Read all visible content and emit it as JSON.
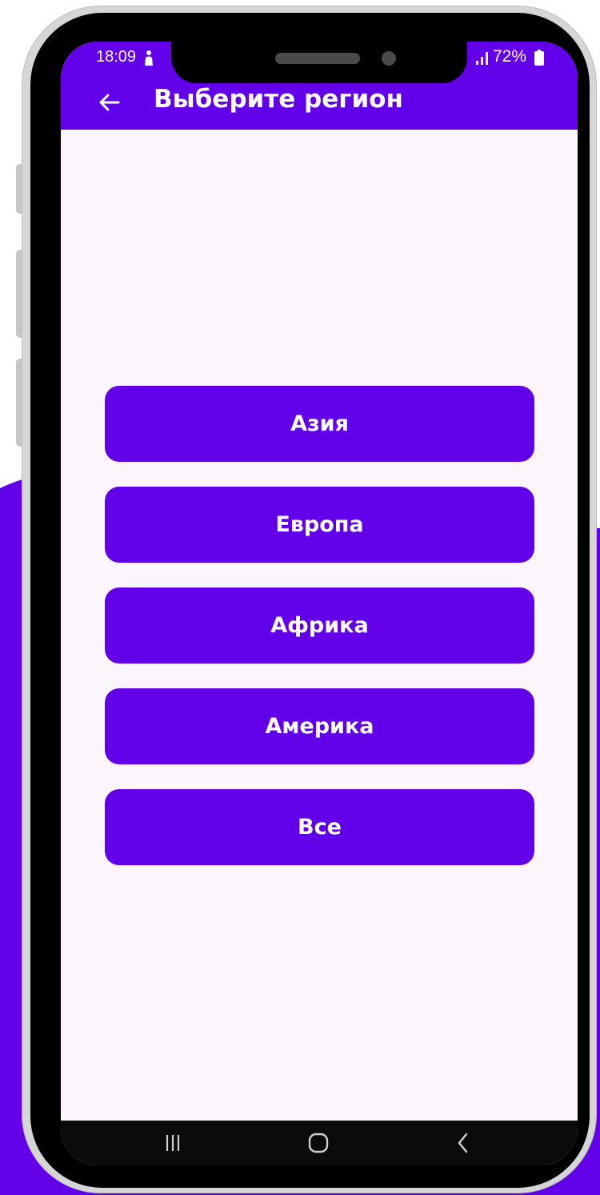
{
  "status_bar": {
    "time": "18:09",
    "battery": "72%",
    "icons": [
      "person-icon",
      "signal-icon",
      "battery-icon"
    ]
  },
  "app_bar": {
    "back_icon": "arrow-left-icon",
    "title": "Выберите регион"
  },
  "regions": [
    {
      "label": "Азия"
    },
    {
      "label": "Европа"
    },
    {
      "label": "Африка"
    },
    {
      "label": "Америка"
    },
    {
      "label": "Все"
    }
  ],
  "navigation_bar": {
    "buttons": [
      "recent-apps-icon",
      "home-icon",
      "back-icon"
    ]
  },
  "colors": {
    "accent": "#6200ea",
    "screen_background": "#fcf5fc",
    "phone_frame": "#000000"
  }
}
